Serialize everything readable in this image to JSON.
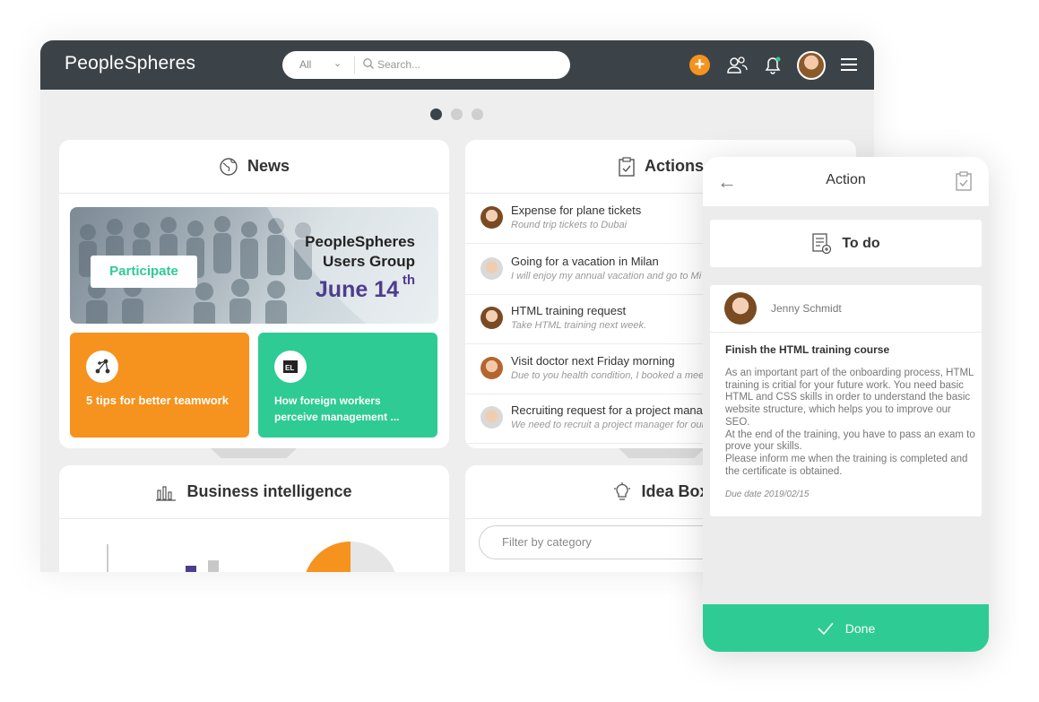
{
  "app": {
    "logo": "PeopleSpheres"
  },
  "search": {
    "filter": "All",
    "placeholder": "Search..."
  },
  "carousel": {
    "pages": 3,
    "active": 1
  },
  "news": {
    "title": "News",
    "banner": {
      "button": "Participate",
      "line1": "PeopleSpheres",
      "line2": "Users Group",
      "date": "June 14",
      "date_sup": "th"
    },
    "tiles": [
      {
        "label": "5 tips for better teamwork"
      },
      {
        "label": "How foreign workers perceive management ..."
      }
    ]
  },
  "actions": {
    "title": "Actions",
    "items": [
      {
        "title": "Expense for plane tickets",
        "subtitle": "Round trip tickets to Dubai"
      },
      {
        "title": "Going for a vacation in Milan",
        "subtitle": "I will enjoy my annual vacation and go to Mi"
      },
      {
        "title": "HTML training request",
        "subtitle": "Take HTML training next week."
      },
      {
        "title": "Visit doctor next Friday morning",
        "subtitle": "Due to you health condition, I booked a mee"
      },
      {
        "title": "Recruiting request for a project manag",
        "subtitle": "We need to recruit a project manager for our"
      }
    ]
  },
  "bi": {
    "title": "Business intelligence"
  },
  "idea": {
    "title": "Idea Box",
    "filter_placeholder": "Filter by category"
  },
  "mobile": {
    "title": "Action",
    "status": "To do",
    "user": "Jenny Schmidt",
    "subject": "Finish the HTML training course",
    "body": "As an important part of the onboarding process, HTML training is critial for your future work. You need basic HTML and CSS skills in order to understand the basic website structure, which helps you to improve our SEO.\nAt the end of the training, you have to pass an exam to prove your skills.\nPlease inform me when the training is completed and the certificate is obtained.",
    "due": "Due date 2019/02/15",
    "done_label": "Done"
  },
  "colors": {
    "topbar": "#3c4348",
    "accent_orange": "#f6921e",
    "accent_green": "#2ecb94",
    "banner_date": "#4e3d8e"
  }
}
